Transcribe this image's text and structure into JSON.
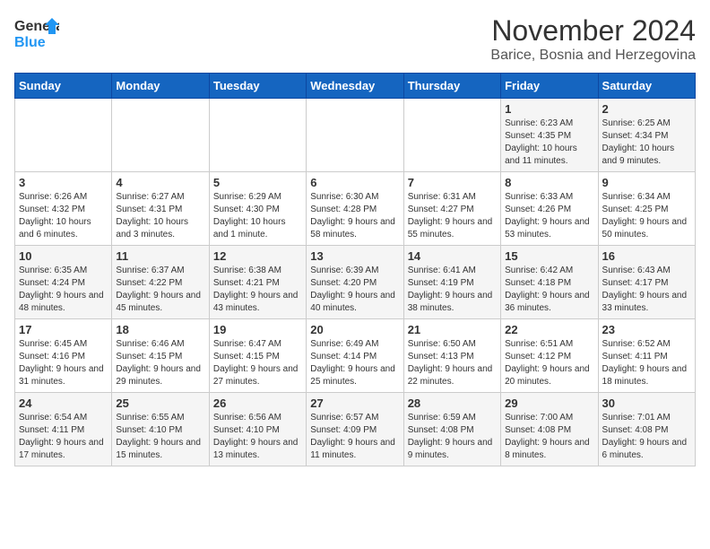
{
  "logo": {
    "line1": "General",
    "line2": "Blue"
  },
  "title": "November 2024",
  "location": "Barice, Bosnia and Herzegovina",
  "days_of_week": [
    "Sunday",
    "Monday",
    "Tuesday",
    "Wednesday",
    "Thursday",
    "Friday",
    "Saturday"
  ],
  "weeks": [
    [
      {
        "day": "",
        "info": ""
      },
      {
        "day": "",
        "info": ""
      },
      {
        "day": "",
        "info": ""
      },
      {
        "day": "",
        "info": ""
      },
      {
        "day": "",
        "info": ""
      },
      {
        "day": "1",
        "info": "Sunrise: 6:23 AM\nSunset: 4:35 PM\nDaylight: 10 hours and 11 minutes."
      },
      {
        "day": "2",
        "info": "Sunrise: 6:25 AM\nSunset: 4:34 PM\nDaylight: 10 hours and 9 minutes."
      }
    ],
    [
      {
        "day": "3",
        "info": "Sunrise: 6:26 AM\nSunset: 4:32 PM\nDaylight: 10 hours and 6 minutes."
      },
      {
        "day": "4",
        "info": "Sunrise: 6:27 AM\nSunset: 4:31 PM\nDaylight: 10 hours and 3 minutes."
      },
      {
        "day": "5",
        "info": "Sunrise: 6:29 AM\nSunset: 4:30 PM\nDaylight: 10 hours and 1 minute."
      },
      {
        "day": "6",
        "info": "Sunrise: 6:30 AM\nSunset: 4:28 PM\nDaylight: 9 hours and 58 minutes."
      },
      {
        "day": "7",
        "info": "Sunrise: 6:31 AM\nSunset: 4:27 PM\nDaylight: 9 hours and 55 minutes."
      },
      {
        "day": "8",
        "info": "Sunrise: 6:33 AM\nSunset: 4:26 PM\nDaylight: 9 hours and 53 minutes."
      },
      {
        "day": "9",
        "info": "Sunrise: 6:34 AM\nSunset: 4:25 PM\nDaylight: 9 hours and 50 minutes."
      }
    ],
    [
      {
        "day": "10",
        "info": "Sunrise: 6:35 AM\nSunset: 4:24 PM\nDaylight: 9 hours and 48 minutes."
      },
      {
        "day": "11",
        "info": "Sunrise: 6:37 AM\nSunset: 4:22 PM\nDaylight: 9 hours and 45 minutes."
      },
      {
        "day": "12",
        "info": "Sunrise: 6:38 AM\nSunset: 4:21 PM\nDaylight: 9 hours and 43 minutes."
      },
      {
        "day": "13",
        "info": "Sunrise: 6:39 AM\nSunset: 4:20 PM\nDaylight: 9 hours and 40 minutes."
      },
      {
        "day": "14",
        "info": "Sunrise: 6:41 AM\nSunset: 4:19 PM\nDaylight: 9 hours and 38 minutes."
      },
      {
        "day": "15",
        "info": "Sunrise: 6:42 AM\nSunset: 4:18 PM\nDaylight: 9 hours and 36 minutes."
      },
      {
        "day": "16",
        "info": "Sunrise: 6:43 AM\nSunset: 4:17 PM\nDaylight: 9 hours and 33 minutes."
      }
    ],
    [
      {
        "day": "17",
        "info": "Sunrise: 6:45 AM\nSunset: 4:16 PM\nDaylight: 9 hours and 31 minutes."
      },
      {
        "day": "18",
        "info": "Sunrise: 6:46 AM\nSunset: 4:15 PM\nDaylight: 9 hours and 29 minutes."
      },
      {
        "day": "19",
        "info": "Sunrise: 6:47 AM\nSunset: 4:15 PM\nDaylight: 9 hours and 27 minutes."
      },
      {
        "day": "20",
        "info": "Sunrise: 6:49 AM\nSunset: 4:14 PM\nDaylight: 9 hours and 25 minutes."
      },
      {
        "day": "21",
        "info": "Sunrise: 6:50 AM\nSunset: 4:13 PM\nDaylight: 9 hours and 22 minutes."
      },
      {
        "day": "22",
        "info": "Sunrise: 6:51 AM\nSunset: 4:12 PM\nDaylight: 9 hours and 20 minutes."
      },
      {
        "day": "23",
        "info": "Sunrise: 6:52 AM\nSunset: 4:11 PM\nDaylight: 9 hours and 18 minutes."
      }
    ],
    [
      {
        "day": "24",
        "info": "Sunrise: 6:54 AM\nSunset: 4:11 PM\nDaylight: 9 hours and 17 minutes."
      },
      {
        "day": "25",
        "info": "Sunrise: 6:55 AM\nSunset: 4:10 PM\nDaylight: 9 hours and 15 minutes."
      },
      {
        "day": "26",
        "info": "Sunrise: 6:56 AM\nSunset: 4:10 PM\nDaylight: 9 hours and 13 minutes."
      },
      {
        "day": "27",
        "info": "Sunrise: 6:57 AM\nSunset: 4:09 PM\nDaylight: 9 hours and 11 minutes."
      },
      {
        "day": "28",
        "info": "Sunrise: 6:59 AM\nSunset: 4:08 PM\nDaylight: 9 hours and 9 minutes."
      },
      {
        "day": "29",
        "info": "Sunrise: 7:00 AM\nSunset: 4:08 PM\nDaylight: 9 hours and 8 minutes."
      },
      {
        "day": "30",
        "info": "Sunrise: 7:01 AM\nSunset: 4:08 PM\nDaylight: 9 hours and 6 minutes."
      }
    ]
  ]
}
